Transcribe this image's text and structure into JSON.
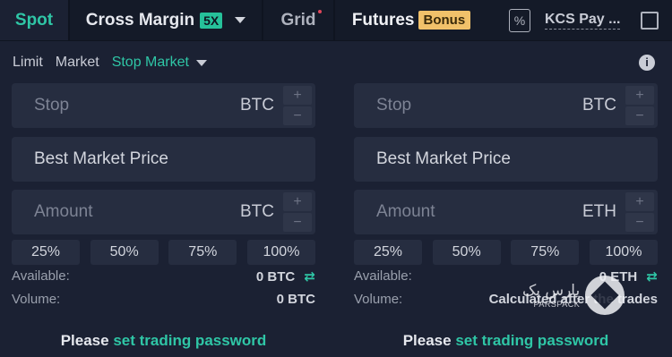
{
  "tabs": {
    "spot": "Spot",
    "cross_margin": "Cross Margin",
    "cross_badge": "5X",
    "grid": "Grid",
    "futures": "Futures",
    "futures_badge": "Bonus",
    "kcs_pay": "KCS Pay ..."
  },
  "order_types": {
    "limit": "Limit",
    "market": "Market",
    "stop_market": "Stop Market"
  },
  "left": {
    "stop_label": "Stop",
    "stop_unit": "BTC",
    "market_label": "Best Market Price",
    "amount_label": "Amount",
    "amount_unit": "BTC",
    "pcts": [
      "25%",
      "50%",
      "75%",
      "100%"
    ],
    "available_label": "Available:",
    "available_value": "0 BTC",
    "volume_label": "Volume:",
    "volume_value": "0 BTC",
    "pw_prefix": "Please",
    "pw_link": "set trading password"
  },
  "right": {
    "stop_label": "Stop",
    "stop_unit": "BTC",
    "market_label": "Best Market Price",
    "amount_label": "Amount",
    "amount_unit": "ETH",
    "pcts": [
      "25%",
      "50%",
      "75%",
      "100%"
    ],
    "available_label": "Available:",
    "available_value": "0 ETH",
    "volume_label": "Volume:",
    "volume_value": "Calculated after the trades",
    "pw_prefix": "Please",
    "pw_link": "set trading password"
  },
  "stepper": {
    "plus": "+",
    "minus": "−"
  },
  "icons": {
    "swap": "⇄",
    "info": "i",
    "percent": "%"
  },
  "watermark": {
    "fa": "پارس پک",
    "en": "PARSPACK"
  },
  "colors": {
    "accent": "#2fc6a6",
    "bonus": "#f1c16a",
    "background": "#1b2133"
  }
}
